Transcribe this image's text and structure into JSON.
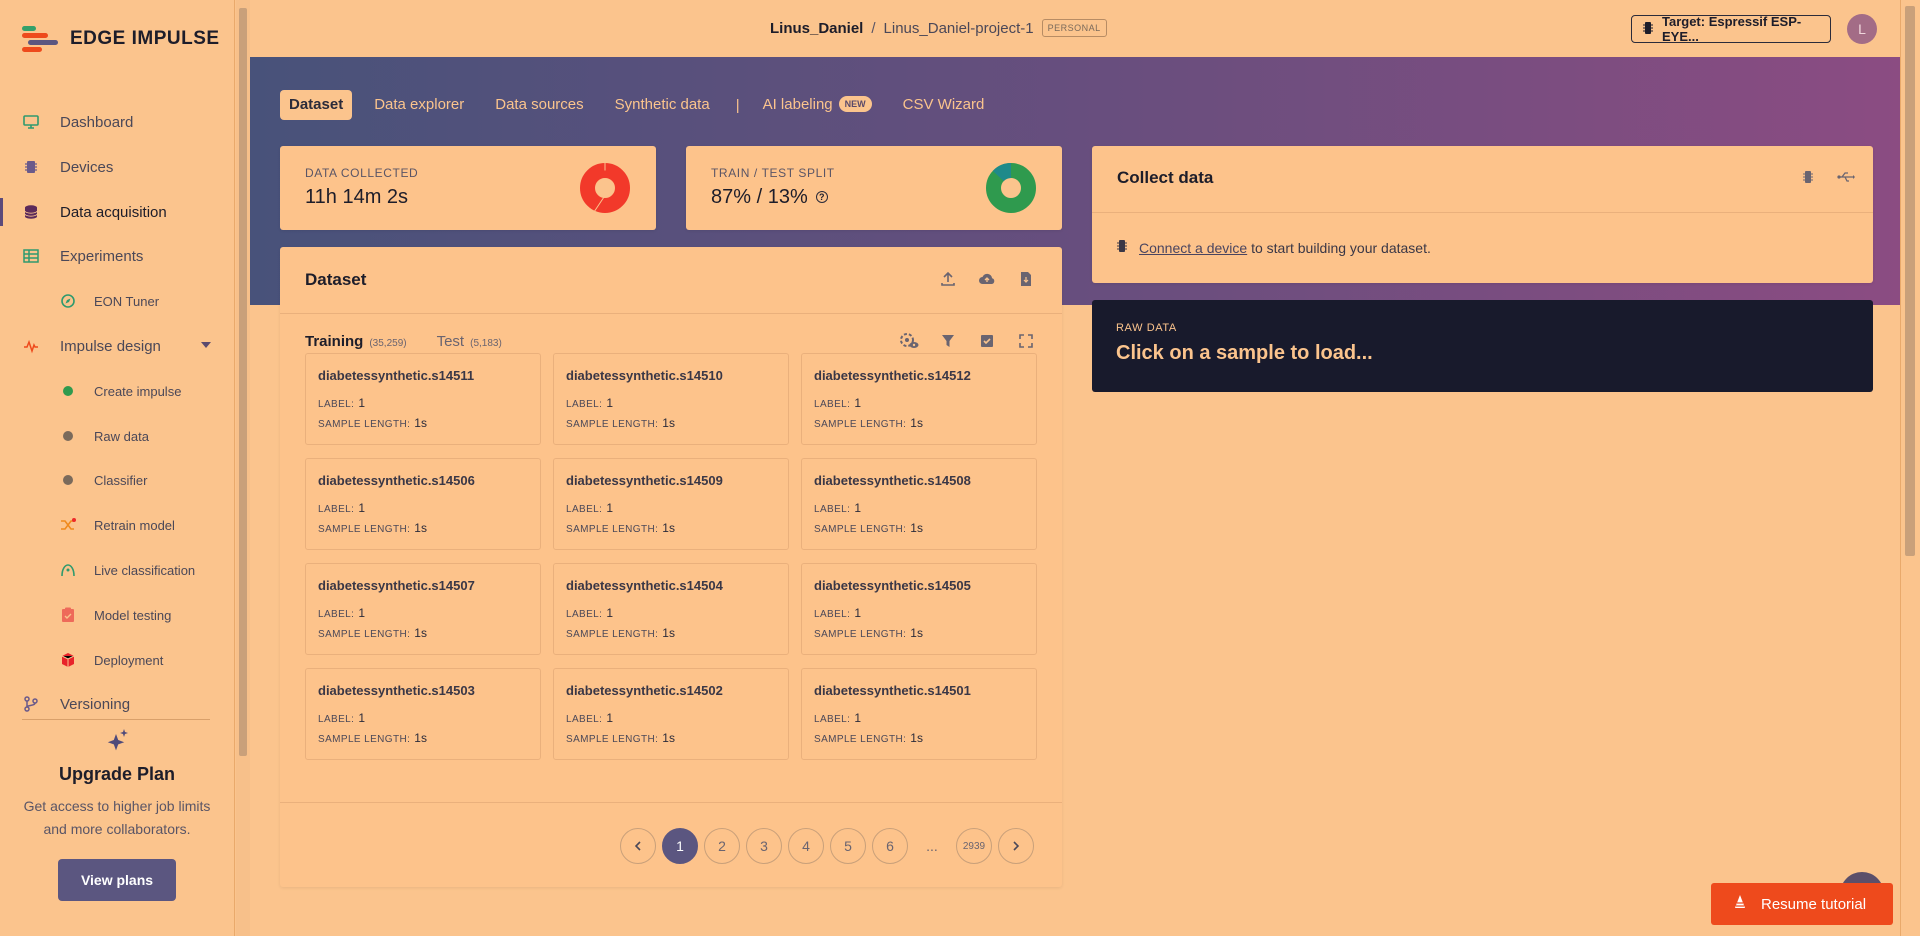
{
  "brand": {
    "name": "EDGE IMPULSE"
  },
  "sidebar": {
    "items": [
      {
        "label": "Dashboard",
        "icon": "monitor-icon"
      },
      {
        "label": "Devices",
        "icon": "chip-icon"
      },
      {
        "label": "Data acquisition",
        "icon": "database-icon",
        "active": true
      },
      {
        "label": "Experiments",
        "icon": "table-icon"
      },
      {
        "label": "EON Tuner",
        "icon": "compass-icon"
      },
      {
        "label": "Impulse design",
        "icon": "pulse-icon"
      },
      {
        "label": "Create impulse",
        "icon": "green-dot-icon"
      },
      {
        "label": "Raw data",
        "icon": "gray-dot-icon"
      },
      {
        "label": "Classifier",
        "icon": "gray-dot-icon"
      },
      {
        "label": "Retrain model",
        "icon": "shuffle-icon"
      },
      {
        "label": "Live classification",
        "icon": "signal-icon"
      },
      {
        "label": "Model testing",
        "icon": "clipboard-icon"
      },
      {
        "label": "Deployment",
        "icon": "box-icon"
      },
      {
        "label": "Versioning",
        "icon": "branch-icon"
      }
    ],
    "upgrade": {
      "title": "Upgrade Plan",
      "text": "Get access to higher job limits and more collaborators.",
      "button": "View plans"
    }
  },
  "topbar": {
    "user": "Linus_Daniel",
    "separator": "/",
    "project": "Linus_Daniel-project-1",
    "badge": "PERSONAL",
    "target": "Target: Espressif ESP-EYE...",
    "avatar_initial": "L"
  },
  "tabs": {
    "dataset": "Dataset",
    "explorer": "Data explorer",
    "sources": "Data sources",
    "synthetic": "Synthetic data",
    "separator": "|",
    "ai_labeling": "AI labeling",
    "new_badge": "NEW",
    "csv": "CSV Wizard"
  },
  "stats": {
    "collected_label": "DATA COLLECTED",
    "collected_value": "11h 14m 2s",
    "split_label": "TRAIN / TEST SPLIT",
    "split_value": "87% / 13%",
    "split_help": "?",
    "split_train_fraction": 0.87
  },
  "dataset": {
    "title": "Dataset",
    "training_label": "Training",
    "training_count": "(35,259)",
    "test_label": "Test",
    "test_count": "(5,183)",
    "label_key": "LABEL:",
    "length_key": "SAMPLE LENGTH:",
    "samples": [
      {
        "name": "diabetessynthetic.s14511",
        "label": "1",
        "length": "1s"
      },
      {
        "name": "diabetessynthetic.s14510",
        "label": "1",
        "length": "1s"
      },
      {
        "name": "diabetessynthetic.s14512",
        "label": "1",
        "length": "1s"
      },
      {
        "name": "diabetessynthetic.s14506",
        "label": "1",
        "length": "1s"
      },
      {
        "name": "diabetessynthetic.s14509",
        "label": "1",
        "length": "1s"
      },
      {
        "name": "diabetessynthetic.s14508",
        "label": "1",
        "length": "1s"
      },
      {
        "name": "diabetessynthetic.s14507",
        "label": "1",
        "length": "1s"
      },
      {
        "name": "diabetessynthetic.s14504",
        "label": "1",
        "length": "1s"
      },
      {
        "name": "diabetessynthetic.s14505",
        "label": "1",
        "length": "1s"
      },
      {
        "name": "diabetessynthetic.s14503",
        "label": "1",
        "length": "1s"
      },
      {
        "name": "diabetessynthetic.s14502",
        "label": "1",
        "length": "1s"
      },
      {
        "name": "diabetessynthetic.s14501",
        "label": "1",
        "length": "1s"
      }
    ],
    "pages": [
      "1",
      "2",
      "3",
      "4",
      "5",
      "6",
      "...",
      "2939"
    ],
    "current_page": "1"
  },
  "collect": {
    "title": "Collect data",
    "link": "Connect a device",
    "rest": " to start building your dataset."
  },
  "raw": {
    "label": "RAW DATA",
    "message": "Click on a sample to load..."
  },
  "tutorial": {
    "label": "Resume tutorial"
  },
  "colors": {
    "background": "#fbc48d",
    "accent": "#5b5680",
    "dark_panel": "#181a2c",
    "tutorial": "#ee4a1c"
  }
}
